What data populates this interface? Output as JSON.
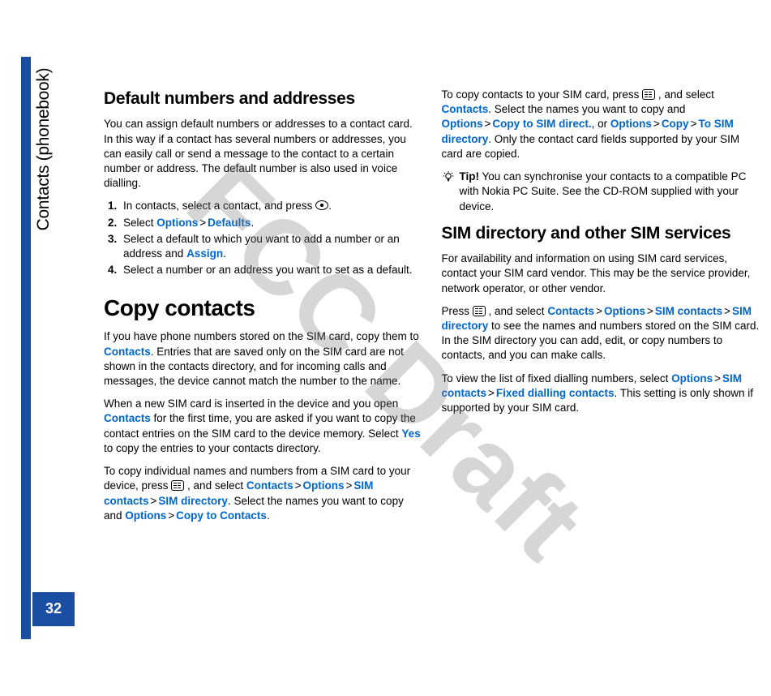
{
  "sideTabLabel": "Contacts (phonebook)",
  "pageNumber": "32",
  "watermark": "FCC Draft",
  "h_default": "Default numbers and addresses",
  "p_default_intro": "You can assign default numbers or addresses to a contact card. In this way if a contact has several numbers or addresses, you can easily call or send a message to the contact to a certain number or address. The default number is also used in voice dialling.",
  "step1_a": "In contacts, select a contact, and press ",
  "step1_b": ".",
  "step2_a": "Select ",
  "link_options": "Options",
  "link_defaults": "Defaults",
  "step2_b": ".",
  "step3_a": "Select a default to which you want to add a number or an address and ",
  "link_assign": "Assign",
  "step3_b": ".",
  "step4": "Select a number or an address you want to set as a default.",
  "h_copy": "Copy contacts",
  "p_copy1_a": "If you have phone numbers stored on the SIM card, copy them to ",
  "link_contacts": "Contacts",
  "p_copy1_b": ". Entries that are saved only on the SIM card are not shown in the contacts directory, and for incoming calls and messages, the device cannot match the number to the name.",
  "p_copy2_a": "When a new SIM card is inserted in the device and you open ",
  "p_copy2_b": " for the first time, you are asked if you want to copy the contact entries on the SIM card to the device memory. Select ",
  "link_yes": "Yes",
  "p_copy2_c": " to copy the entries to your contacts directory.",
  "p_copy3_a": "To copy individual names and numbers from a SIM card to your device, press ",
  "p_copy3_b": " , and select ",
  "link_sim_contacts": "SIM contacts",
  "link_sim_directory": "SIM directory",
  "p_copy3_c": ". Select the names you want to copy and ",
  "link_copy_to_contacts": "Copy to Contacts",
  "p_copy3_d": ".",
  "p_copy4_a": "To copy contacts to your SIM card, press ",
  "p_copy4_b": " , and select ",
  "p_copy4_c": ". Select the names you want to copy and ",
  "link_copy_to_sim_direct": "Copy to SIM direct.",
  "p_copy4_d": ", or ",
  "link_copy": "Copy",
  "link_to_sim_directory": "To SIM directory",
  "p_copy4_e": ". Only the contact card fields supported by your SIM card are copied.",
  "tip_label": "Tip!",
  "tip_text": " You can synchronise your contacts to a compatible PC with Nokia PC Suite. See the CD-ROM supplied with your device.",
  "h_sim": "SIM directory and other SIM services",
  "p_sim1": "For availability and information on using SIM card services, contact your SIM card vendor. This may be the service provider, network operator, or other vendor.",
  "p_sim2_a": "Press ",
  "p_sim2_b": " , and select ",
  "p_sim2_c": " to see the names and numbers stored on the SIM card. In the SIM directory you can add, edit, or copy numbers to contacts, and you can make calls.",
  "p_sim3_a": "To view the list of fixed dialling numbers, select ",
  "link_fixed": "Fixed dialling contacts",
  "p_sim3_b": ". This setting is only shown if supported by your SIM card.",
  "gt": ">"
}
